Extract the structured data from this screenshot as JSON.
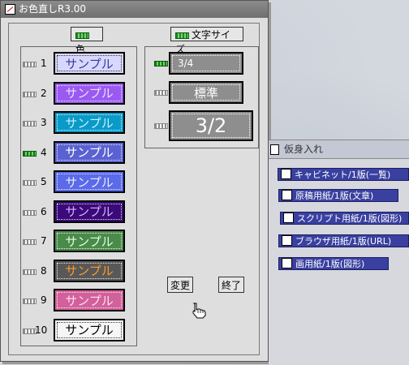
{
  "window": {
    "title": "お色直しR3.00"
  },
  "headers": {
    "color_label": "色",
    "size_label": "文字サイズ"
  },
  "color_rows": [
    {
      "number": "1",
      "text": "サンプル",
      "bg": "#d8d8ff",
      "fg": "#3a3a9a",
      "selected": false
    },
    {
      "number": "2",
      "text": "サンプル",
      "bg": "#9a5af2",
      "fg": "#e8e0ff",
      "selected": false
    },
    {
      "number": "3",
      "text": "サンプル",
      "bg": "#0a9ac8",
      "fg": "#c8f0ff",
      "selected": false
    },
    {
      "number": "4",
      "text": "サンプル",
      "bg": "#5a62d2",
      "fg": "#ffffff",
      "selected": true
    },
    {
      "number": "5",
      "text": "サンプル",
      "bg": "#5a6ae8",
      "fg": "#e8ecff",
      "selected": false
    },
    {
      "number": "6",
      "text": "サンプル",
      "bg": "#3a0a78",
      "fg": "#d0b0ff",
      "selected": false
    },
    {
      "number": "7",
      "text": "サンプル",
      "bg": "#4a8a4a",
      "fg": "#e0ffe0",
      "selected": false
    },
    {
      "number": "8",
      "text": "サンプル",
      "bg": "#585858",
      "fg": "#ff9a2a",
      "selected": false
    },
    {
      "number": "9",
      "text": "サンプル",
      "bg": "#d2609a",
      "fg": "#ffe0f0",
      "selected": false
    },
    {
      "number": "10",
      "text": "サンプル",
      "bg": "#f6f6f6",
      "fg": "#000000",
      "selected": false
    }
  ],
  "size_rows": [
    {
      "text": "3/4",
      "selected": true
    },
    {
      "text": "標準",
      "selected": false
    },
    {
      "text": "3/2",
      "selected": false
    }
  ],
  "buttons": {
    "change": "変更",
    "close": "終了"
  },
  "secondary_window": {
    "title": "仮身入れ",
    "items": [
      {
        "label": "キャビネット/1版(一覧)"
      },
      {
        "label": "原稿用紙/1版(文章)"
      },
      {
        "label": "スクリプト用紙/1版(図形)"
      },
      {
        "label": "ブラウザ用紙/1版(URL)"
      },
      {
        "label": "画用紙/1版(図形)"
      }
    ]
  },
  "icons": [
    "window-icon",
    "color-indicator-icon",
    "size-indicator-icon",
    "hand-pointer-icon",
    "document-icon"
  ]
}
